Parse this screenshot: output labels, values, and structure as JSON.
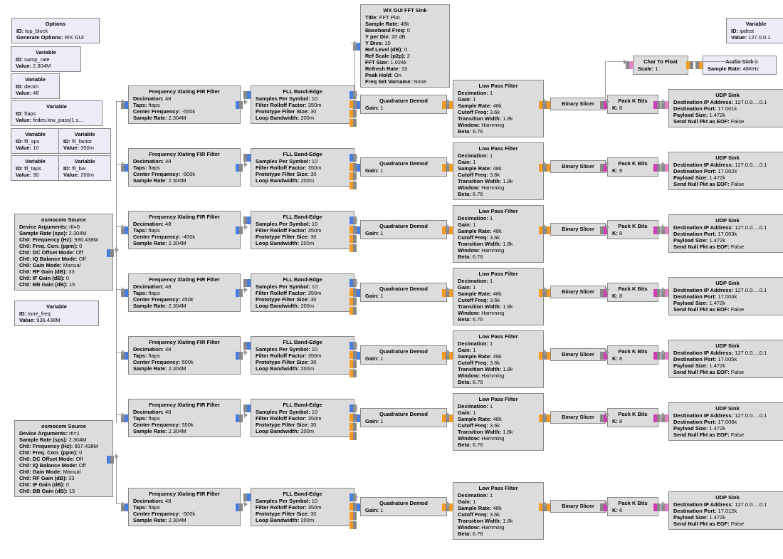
{
  "options": {
    "title": "Options",
    "fields": [
      [
        "ID",
        "top_block"
      ],
      [
        "Generate Options",
        "WX GUI"
      ]
    ]
  },
  "vars_top": [
    {
      "title": "Variable",
      "fields": [
        [
          "ID",
          "samp_rate"
        ],
        [
          "Value",
          "2.304M"
        ]
      ]
    },
    {
      "title": "Variable",
      "fields": [
        [
          "ID",
          "decim"
        ],
        [
          "Value",
          "48"
        ]
      ]
    },
    {
      "title": "Variable",
      "fields": [
        [
          "ID",
          "ftaps"
        ],
        [
          "Value",
          "firdes.low_pass(1.s…"
        ]
      ]
    }
  ],
  "vars_pair": [
    [
      {
        "title": "Variable",
        "fields": [
          [
            "ID",
            "fll_sps"
          ],
          [
            "Value",
            "10"
          ]
        ]
      },
      {
        "title": "Variable",
        "fields": [
          [
            "ID",
            "fll_factor"
          ],
          [
            "Value",
            "350m"
          ]
        ]
      }
    ],
    [
      {
        "title": "Variable",
        "fields": [
          [
            "ID",
            "fll_taps"
          ],
          [
            "Value",
            "30"
          ]
        ]
      },
      {
        "title": "Variable",
        "fields": [
          [
            "ID",
            "fll_bw"
          ],
          [
            "Value",
            "200m"
          ]
        ]
      }
    ]
  ],
  "ipdest": {
    "title": "Variable",
    "fields": [
      [
        "ID",
        "ipdest"
      ],
      [
        "Value",
        "127.0.0.1"
      ]
    ]
  },
  "charfloat": {
    "title": "Char To Float",
    "fields": [
      [
        "Scale",
        "1"
      ]
    ]
  },
  "audiosink": {
    "title": "Audio Sink",
    "fields": [
      [
        "Sample Rate",
        "48KHz"
      ]
    ]
  },
  "tune": {
    "title": "Variable",
    "fields": [
      [
        "ID",
        "tune_freq"
      ],
      [
        "Value",
        "936.438M"
      ]
    ]
  },
  "sources": [
    {
      "title": "osmocom Source",
      "fields": [
        [
          "Device Arguments",
          "rtl=0"
        ],
        [
          "Sample Rate (sps)",
          "2.304M"
        ],
        [
          "Ch0: Frequency (Hz)",
          "936.438M"
        ],
        [
          "Ch0: Freq. Corr. (ppm)",
          "0"
        ],
        [
          "Ch0: DC Offset Mode",
          "Off"
        ],
        [
          "Ch0: IQ Balance Mode",
          "Off"
        ],
        [
          "Ch0: Gain Mode",
          "Manual"
        ],
        [
          "Ch0: RF Gain (dB)",
          "33"
        ],
        [
          "Ch0: IF Gain (dB)",
          "0"
        ],
        [
          "Ch0: BB Gain (dB)",
          "15"
        ]
      ]
    },
    {
      "title": "osmocom Source",
      "fields": [
        [
          "Device Arguments",
          "rtl=1"
        ],
        [
          "Sample Rate (sps)",
          "2.304M"
        ],
        [
          "Ch0: Frequency (Hz)",
          "897.438M"
        ],
        [
          "Ch0: Freq. Corr. (ppm)",
          "0"
        ],
        [
          "Ch0: DC Offset Mode",
          "Off"
        ],
        [
          "Ch0: IQ Balance Mode",
          "Off"
        ],
        [
          "Ch0: Gain Mode",
          "Manual"
        ],
        [
          "Ch0: RF Gain (dB)",
          "33"
        ],
        [
          "Ch0: IF Gain (dB)",
          "0"
        ],
        [
          "Ch0: BB Gain (dB)",
          "15"
        ]
      ]
    }
  ],
  "fftsink": {
    "title": "WX GUI FFT Sink",
    "fields": [
      [
        "Title",
        "FFT Plot"
      ],
      [
        "Sample Rate",
        "48k"
      ],
      [
        "Baseband Freq",
        "0"
      ],
      [
        "Y per Div",
        "20 dB"
      ],
      [
        "Y Divs",
        "10"
      ],
      [
        "Ref Level (dB)",
        "0"
      ],
      [
        "Ref Scale (p2p)",
        "2"
      ],
      [
        "FFT Size",
        "1.024k"
      ],
      [
        "Refresh Rate",
        "15"
      ],
      [
        "Peak Hold",
        "On"
      ],
      [
        "Freq Set Varname",
        "None"
      ]
    ]
  },
  "chains": [
    {
      "fir": "-550k",
      "port": "17.001k"
    },
    {
      "fir": "-500k",
      "port": "17.002k"
    },
    {
      "fir": "-450k",
      "port": "17.003k"
    },
    {
      "fir": "450k",
      "port": "17.004k"
    },
    {
      "fir": "500k",
      "port": "17.005k"
    },
    {
      "fir": "550k",
      "port": "17.006k"
    },
    {
      "fir": "-500k",
      "port": "17.012k"
    }
  ],
  "fir": {
    "title": "Frequency Xlating FIR Filter",
    "fields": [
      [
        "Decimation",
        "48"
      ],
      [
        "Taps",
        "ftaps"
      ],
      [
        "Center Frequency",
        ""
      ],
      [
        "Sample Rate",
        "2.304M"
      ]
    ]
  },
  "fll": {
    "title": "FLL Band-Edge",
    "fields": [
      [
        "Samples Per Symbol",
        "10"
      ],
      [
        "Filter Rolloff Factor",
        "350m"
      ],
      [
        "Prototype Filter Size",
        "30"
      ],
      [
        "Loop Bandwidth",
        "200m"
      ]
    ]
  },
  "qdem": {
    "title": "Quadrature Demod",
    "fields": [
      [
        "Gain",
        "1"
      ]
    ]
  },
  "lpf": {
    "title": "Low Pass Filter",
    "fields": [
      [
        "Decimation",
        "1"
      ],
      [
        "Gain",
        "1"
      ],
      [
        "Sample Rate",
        "48k"
      ],
      [
        "Cutoff Freq",
        "3.6k"
      ],
      [
        "Transition Width",
        "1.8k"
      ],
      [
        "Window",
        "Hamming"
      ],
      [
        "Beta",
        "6.76"
      ]
    ]
  },
  "slicer": {
    "title": "Binary Slicer"
  },
  "pack": {
    "title": "Pack K Bits",
    "fields": [
      [
        "K",
        "8"
      ]
    ]
  },
  "udp": {
    "title": "UDP Sink",
    "fields": [
      [
        "Destination IP Address",
        "127.0.0….0.1"
      ],
      [
        "Destination Port",
        ""
      ],
      [
        "Payload Size",
        "1.472k"
      ],
      [
        "Send Null Pkt as EOF",
        "False"
      ]
    ]
  }
}
